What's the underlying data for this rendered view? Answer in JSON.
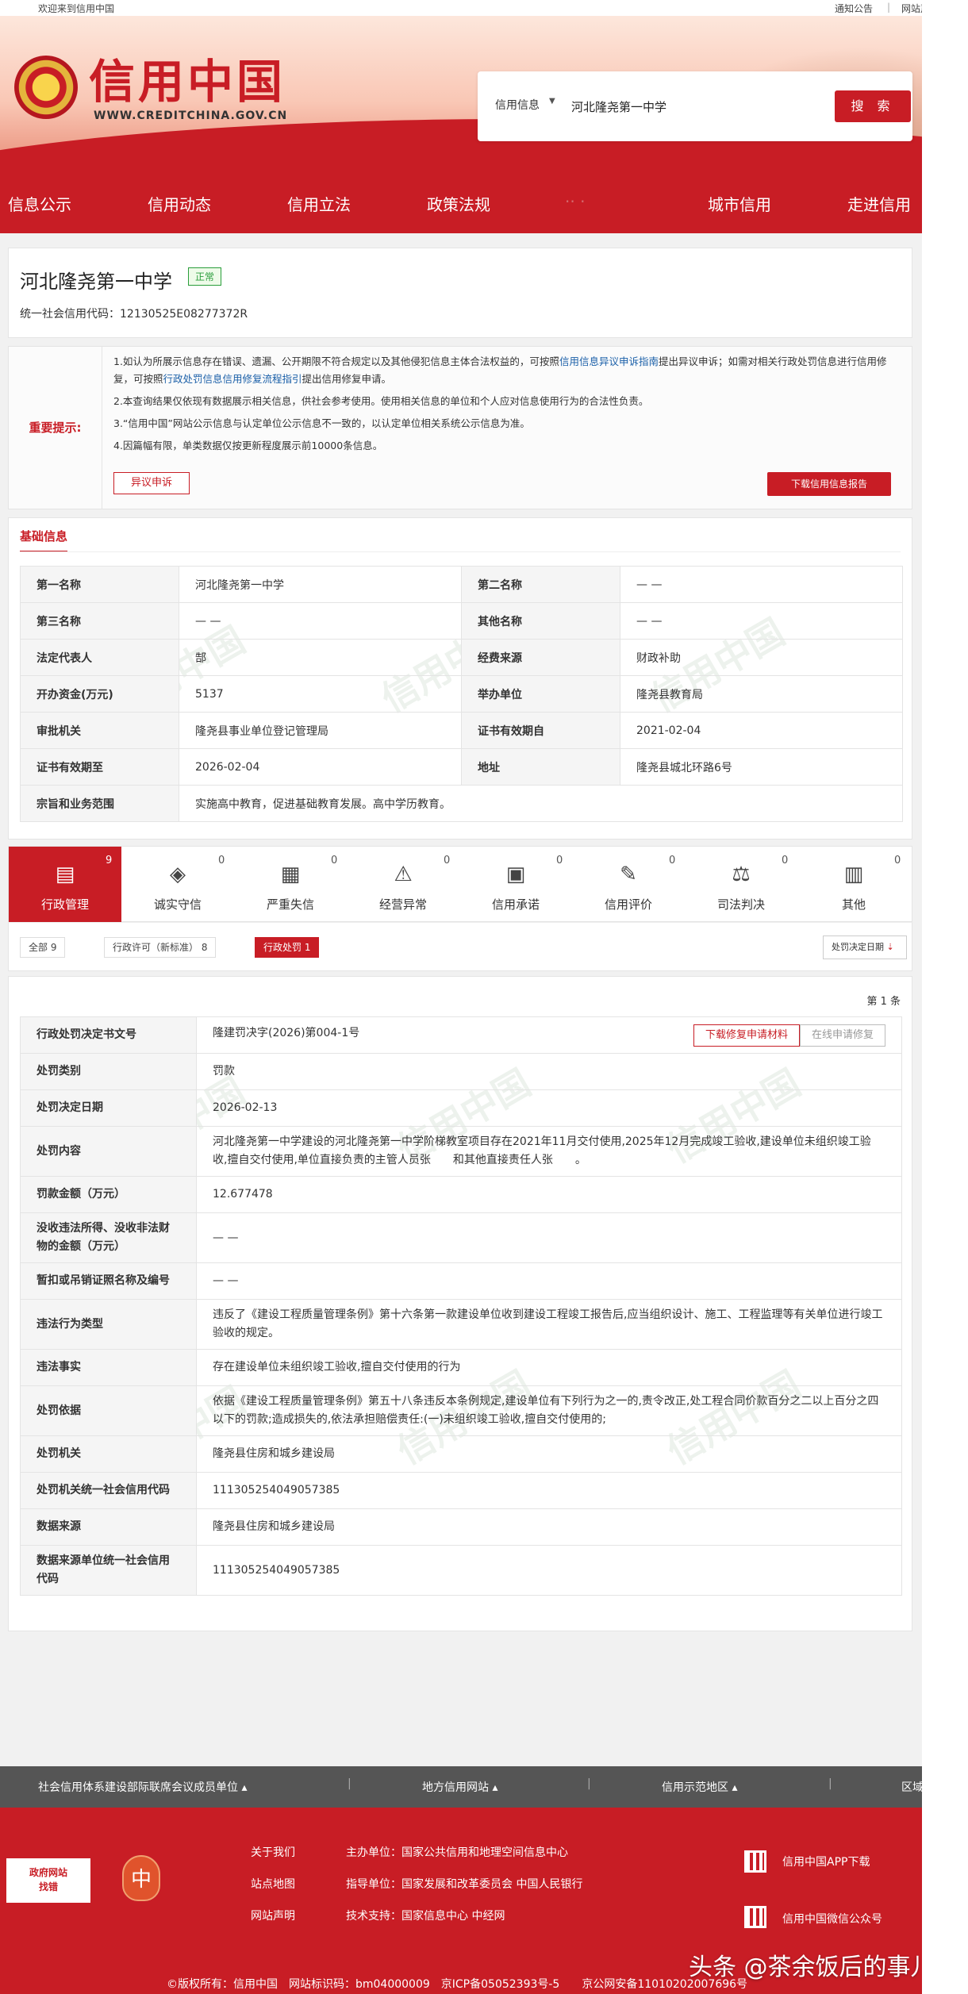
{
  "topbar": {
    "welcome": "欢迎来到信用中国",
    "notice": "通知公告",
    "separator": "|",
    "statement": "网站声明"
  },
  "logo": {
    "cn": "信用中国",
    "en": "WWW.CREDITCHINA.GOV.CN",
    "emblem_glyph": "★"
  },
  "search": {
    "type": "信用信息",
    "caret": "▼",
    "value": "河北隆尧第一中学",
    "button": "搜 索"
  },
  "nav": [
    "信息公示",
    "信用动态",
    "信用立法",
    "政策法规",
    "·· ·",
    "城市信用",
    "走进信用"
  ],
  "entity": {
    "name": "河北隆尧第一中学",
    "status": "正常",
    "code_label": "统一社会信用代码：",
    "code": "12130525E08277372R"
  },
  "tips": {
    "label": "重要提示:",
    "l1a": "1.如认为所展示信息存在错误、遗漏、公开期限不符合规定以及其他侵犯信息主体合法权益的，可按照",
    "l1link": "信用信息异议申诉指南",
    "l1b": "提出异议申诉；如需对相关行政处罚信息进行信用修复，可按照",
    "l1link2": "行政处罚信息信用修复流程指引",
    "l1c": "提出信用修复申请。",
    "l2": "2.本查询结果仅依现有数据展示相关信息，供社会参考使用。使用相关信息的单位和个人应对信息使用行为的合法性负责。",
    "l3": "3.“信用中国”网站公示信息与认定单位公示信息不一致的，以认定单位相关系统公示信息为准。",
    "l4": "4.因篇幅有限，单类数据仅按更新程度展示前10000条信息。",
    "objection": "异议申诉",
    "download": "下载信用信息报告"
  },
  "basic": {
    "title": "基础信息",
    "rows": [
      [
        "第一名称",
        "河北隆尧第一中学",
        "第二名称",
        "— —"
      ],
      [
        "第三名称",
        "— —",
        "其他名称",
        "— —"
      ],
      [
        "法定代表人",
        "郜",
        "经费来源",
        "财政补助"
      ],
      [
        "开办资金(万元)",
        "5137",
        "举办单位",
        "隆尧县教育局"
      ],
      [
        "审批机关",
        "隆尧县事业单位登记管理局",
        "证书有效期自",
        "2021-02-04"
      ],
      [
        "证书有效期至",
        "2026-02-04",
        "地址",
        "隆尧县城北环路6号"
      ]
    ],
    "scope_label": "宗旨和业务范围",
    "scope": "实施高中教育，促进基础教育发展。高中学历教育。"
  },
  "tabs": [
    {
      "label": "行政管理",
      "count": "9",
      "icon": "▤"
    },
    {
      "label": "诚实守信",
      "count": "0",
      "icon": "◈"
    },
    {
      "label": "严重失信",
      "count": "0",
      "icon": "▦"
    },
    {
      "label": "经营异常",
      "count": "0",
      "icon": "⚠"
    },
    {
      "label": "信用承诺",
      "count": "0",
      "icon": "▣"
    },
    {
      "label": "信用评价",
      "count": "0",
      "icon": "✎"
    },
    {
      "label": "司法判决",
      "count": "0",
      "icon": "⚖"
    },
    {
      "label": "其他",
      "count": "0",
      "icon": "▥"
    }
  ],
  "filters": {
    "all": "全部  9",
    "license": "行政许可（新标准）  8",
    "penalty": "行政处罚  1",
    "sort": "处罚决定日期",
    "sort_icon": "⇣"
  },
  "detail": {
    "count": "第 1 条",
    "btn_download": "下载修复申请材料",
    "btn_online": "在线申请修复",
    "rows": [
      [
        "行政处罚决定书文号",
        "隆建罚决字(2026)第004-1号"
      ],
      [
        "处罚类别",
        "罚款"
      ],
      [
        "处罚决定日期",
        "2026-02-13"
      ],
      [
        "处罚内容",
        "河北隆尧第一中学建设的河北隆尧第一中学阶梯教室项目存在2021年11月交付使用,2025年12月完成竣工验收,建设单位未组织竣工验收,擅自交付使用,单位直接负责的主管人员张　　和其他直接责任人张　　。"
      ],
      [
        "罚款金额（万元）",
        "12.677478"
      ],
      [
        "没收违法所得、没收非法财物的金额（万元）",
        "— —"
      ],
      [
        "暂扣或吊销证照名称及编号",
        "— —"
      ],
      [
        "违法行为类型",
        "违反了《建设工程质量管理条例》第十六条第一款建设单位收到建设工程竣工报告后,应当组织设计、施工、工程监理等有关单位进行竣工验收的规定。"
      ],
      [
        "违法事实",
        "存在建设单位未组织竣工验收,擅自交付使用的行为"
      ],
      [
        "处罚依据",
        "依据《建设工程质量管理条例》第五十八条违反本条例规定,建设单位有下列行为之一的,责令改正,处工程合同价款百分之二以上百分之四以下的罚款;造成损失的,依法承担赔偿责任:(一)未组织竣工验收,擅自交付使用的;"
      ],
      [
        "处罚机关",
        "隆尧县住房和城乡建设局"
      ],
      [
        "处罚机关统一社会信用代码",
        "111305254049057385"
      ],
      [
        "数据来源",
        "隆尧县住房和城乡建设局"
      ],
      [
        "数据来源单位统一社会信用代码",
        "111305254049057385"
      ]
    ]
  },
  "watermark": "信用中国",
  "footlinks": {
    "a": "社会信用体系建设部际联席会议成员单位  ▴",
    "b": "地方信用网站  ▴",
    "c": "信用示范地区  ▴",
    "d": "区域  ▴",
    "sep": "|"
  },
  "footer": {
    "gov1": "政府网站",
    "gov2": "找错",
    "jub": "中",
    "about": "关于我们",
    "map": "站点地图",
    "stmt": "网站声明",
    "host": "主办单位：国家公共信用和地理空间信息中心",
    "guide": "指导单位：国家发展和改革委员会 中国人民银行",
    "tech": "技术支持：国家信息中心 中经网",
    "app": "信用中国APP下载",
    "wechat": "信用中国微信公众号",
    "copy": "©版权所有：信用中国　网站标识码：bm04000009　京ICP备05052393号-5　　京公网安备11010202007696号",
    "watermark": "头条 @茶余饭后的事儿"
  }
}
